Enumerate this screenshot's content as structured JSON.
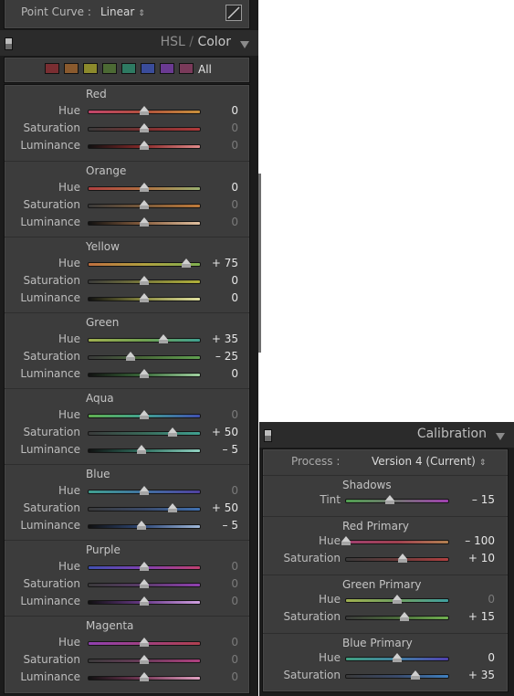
{
  "tone_curve": {
    "point_curve_label": "Point Curve :",
    "point_curve_value": "Linear",
    "updown_glyph": "↕"
  },
  "hsl": {
    "title_hsl": "HSL",
    "title_sep": " / ",
    "title_color": "Color",
    "swatches": [
      {
        "name": "red",
        "color": "#7a2e32"
      },
      {
        "name": "orange",
        "color": "#8a5a2e"
      },
      {
        "name": "yellow",
        "color": "#8c8a2c"
      },
      {
        "name": "green",
        "color": "#4c6a34"
      },
      {
        "name": "aqua",
        "color": "#2e7a62"
      },
      {
        "name": "blue",
        "color": "#3a4c9a"
      },
      {
        "name": "purple",
        "color": "#6a3a92"
      },
      {
        "name": "magenta",
        "color": "#7a3a5a"
      }
    ],
    "all_label": "All",
    "groups": [
      {
        "title": "Red",
        "rows": [
          {
            "label": "Hue",
            "value": "0",
            "pos": 0,
            "dim": false,
            "grad": "linear-gradient(90deg,#c2456b,#b0503c 50%,#c8903c)"
          },
          {
            "label": "Saturation",
            "value": "0",
            "pos": 0,
            "dim": true,
            "grad": "linear-gradient(90deg,#3a3a3a,#7a3030 50%,#b03a3a)"
          },
          {
            "label": "Luminance",
            "value": "0",
            "pos": 0,
            "dim": true,
            "grad": "linear-gradient(90deg,#101010,#8a2a2a 50%,#e08a8a)"
          }
        ]
      },
      {
        "title": "Orange",
        "rows": [
          {
            "label": "Hue",
            "value": "0",
            "pos": 0,
            "dim": false,
            "grad": "linear-gradient(90deg,#b04040,#b07040 50%,#9ab070)"
          },
          {
            "label": "Saturation",
            "value": "0",
            "pos": 0,
            "dim": true,
            "grad": "linear-gradient(90deg,#3a3a3a,#7a5a3a 50%,#c07a3a)"
          },
          {
            "label": "Luminance",
            "value": "0",
            "pos": 0,
            "dim": true,
            "grad": "linear-gradient(90deg,#101010,#8a6040 50%,#e0c0a0)"
          }
        ]
      },
      {
        "title": "Yellow",
        "rows": [
          {
            "label": "Hue",
            "value": "+ 75",
            "pos": 75,
            "dim": false,
            "grad": "linear-gradient(90deg,#c07040,#b0a040 50%,#80b050)"
          },
          {
            "label": "Saturation",
            "value": "0",
            "pos": 0,
            "dim": false,
            "grad": "linear-gradient(90deg,#3a3a3a,#7a7a3a 50%,#b0b03a)"
          },
          {
            "label": "Luminance",
            "value": "0",
            "pos": 0,
            "dim": false,
            "grad": "linear-gradient(90deg,#101010,#8a8a40 50%,#e0e0a0)"
          }
        ]
      },
      {
        "title": "Green",
        "rows": [
          {
            "label": "Hue",
            "value": "+ 35",
            "pos": 35,
            "dim": false,
            "grad": "linear-gradient(90deg,#a0b050,#70a050 50%,#40a090)"
          },
          {
            "label": "Saturation",
            "value": "– 25",
            "pos": -25,
            "dim": false,
            "grad": "linear-gradient(90deg,#3a3a3a,#4a6a3a 50%,#60a050)"
          },
          {
            "label": "Luminance",
            "value": "0",
            "pos": 0,
            "dim": false,
            "grad": "linear-gradient(90deg,#101010,#3a6a3a 50%,#a0d0a0)"
          }
        ]
      },
      {
        "title": "Aqua",
        "rows": [
          {
            "label": "Hue",
            "value": "0",
            "pos": 0,
            "dim": true,
            "grad": "linear-gradient(90deg,#60b050,#40a090 50%,#4050b0)"
          },
          {
            "label": "Saturation",
            "value": "+ 50",
            "pos": 50,
            "dim": false,
            "grad": "linear-gradient(90deg,#3a3a3a,#3a6a5a 50%,#40a090)"
          },
          {
            "label": "Luminance",
            "value": "– 5",
            "pos": -5,
            "dim": false,
            "grad": "linear-gradient(90deg,#101010,#307060 50%,#90d0c0)"
          }
        ]
      },
      {
        "title": "Blue",
        "rows": [
          {
            "label": "Hue",
            "value": "0",
            "pos": 0,
            "dim": true,
            "grad": "linear-gradient(90deg,#40a090,#4070a0 50%,#5040a0)"
          },
          {
            "label": "Saturation",
            "value": "+ 50",
            "pos": 50,
            "dim": false,
            "grad": "linear-gradient(90deg,#3a3a3a,#3a4a6a 50%,#4070b0)"
          },
          {
            "label": "Luminance",
            "value": "– 5",
            "pos": -5,
            "dim": false,
            "grad": "linear-gradient(90deg,#101010,#304a7a 50%,#a0b8d8)"
          }
        ]
      },
      {
        "title": "Purple",
        "rows": [
          {
            "label": "Hue",
            "value": "0",
            "pos": 0,
            "dim": true,
            "grad": "linear-gradient(90deg,#4050b0,#8040b0 50%,#c04070)"
          },
          {
            "label": "Saturation",
            "value": "0",
            "pos": 0,
            "dim": true,
            "grad": "linear-gradient(90deg,#3a3a3a,#5a3a6a 50%,#9040b0)"
          },
          {
            "label": "Luminance",
            "value": "0",
            "pos": 0,
            "dim": true,
            "grad": "linear-gradient(90deg,#101010,#6a3a8a 50%,#d0a0e0)"
          }
        ]
      },
      {
        "title": "Magenta",
        "rows": [
          {
            "label": "Hue",
            "value": "0",
            "pos": 0,
            "dim": true,
            "grad": "linear-gradient(90deg,#9040b0,#a04080 50%,#b04050)"
          },
          {
            "label": "Saturation",
            "value": "0",
            "pos": 0,
            "dim": true,
            "grad": "linear-gradient(90deg,#3a3a3a,#6a3a5a 50%,#b04080)"
          },
          {
            "label": "Luminance",
            "value": "0",
            "pos": 0,
            "dim": true,
            "grad": "linear-gradient(90deg,#101010,#7a3a5a 50%,#e0a0c0)"
          }
        ]
      }
    ]
  },
  "calibration": {
    "title": "Calibration",
    "process_label": "Process :",
    "process_value": "Version 4 (Current)",
    "groups": [
      {
        "title": "Shadows",
        "rows": [
          {
            "label": "Tint",
            "value": "– 15",
            "pos": -15,
            "dim": false,
            "grad": "linear-gradient(90deg,#50a050,#707070 50%,#a040b0)"
          }
        ]
      },
      {
        "title": "Red Primary",
        "rows": [
          {
            "label": "Hue",
            "value": "– 100",
            "pos": -100,
            "dim": false,
            "grad": "linear-gradient(90deg,#a04070,#a04050 50%,#b08050)"
          },
          {
            "label": "Saturation",
            "value": "+ 10",
            "pos": 10,
            "dim": false,
            "grad": "linear-gradient(90deg,#3a3a3a,#6a3a3a 50%,#b04040)"
          }
        ]
      },
      {
        "title": "Green Primary",
        "rows": [
          {
            "label": "Hue",
            "value": "0",
            "pos": 0,
            "dim": true,
            "grad": "linear-gradient(90deg,#a0b050,#70a060 50%,#40a0a0)"
          },
          {
            "label": "Saturation",
            "value": "+ 15",
            "pos": 15,
            "dim": false,
            "grad": "linear-gradient(90deg,#3a3a3a,#4a6a3a 50%,#70b050)"
          }
        ]
      },
      {
        "title": "Blue Primary",
        "rows": [
          {
            "label": "Hue",
            "value": "0",
            "pos": 0,
            "dim": false,
            "grad": "linear-gradient(90deg,#40a080,#4080a0 50%,#5040b0)"
          },
          {
            "label": "Saturation",
            "value": "+ 35",
            "pos": 35,
            "dim": false,
            "grad": "linear-gradient(90deg,#3a3a3a,#3a4a6a 50%,#4080c0)"
          }
        ]
      }
    ]
  }
}
